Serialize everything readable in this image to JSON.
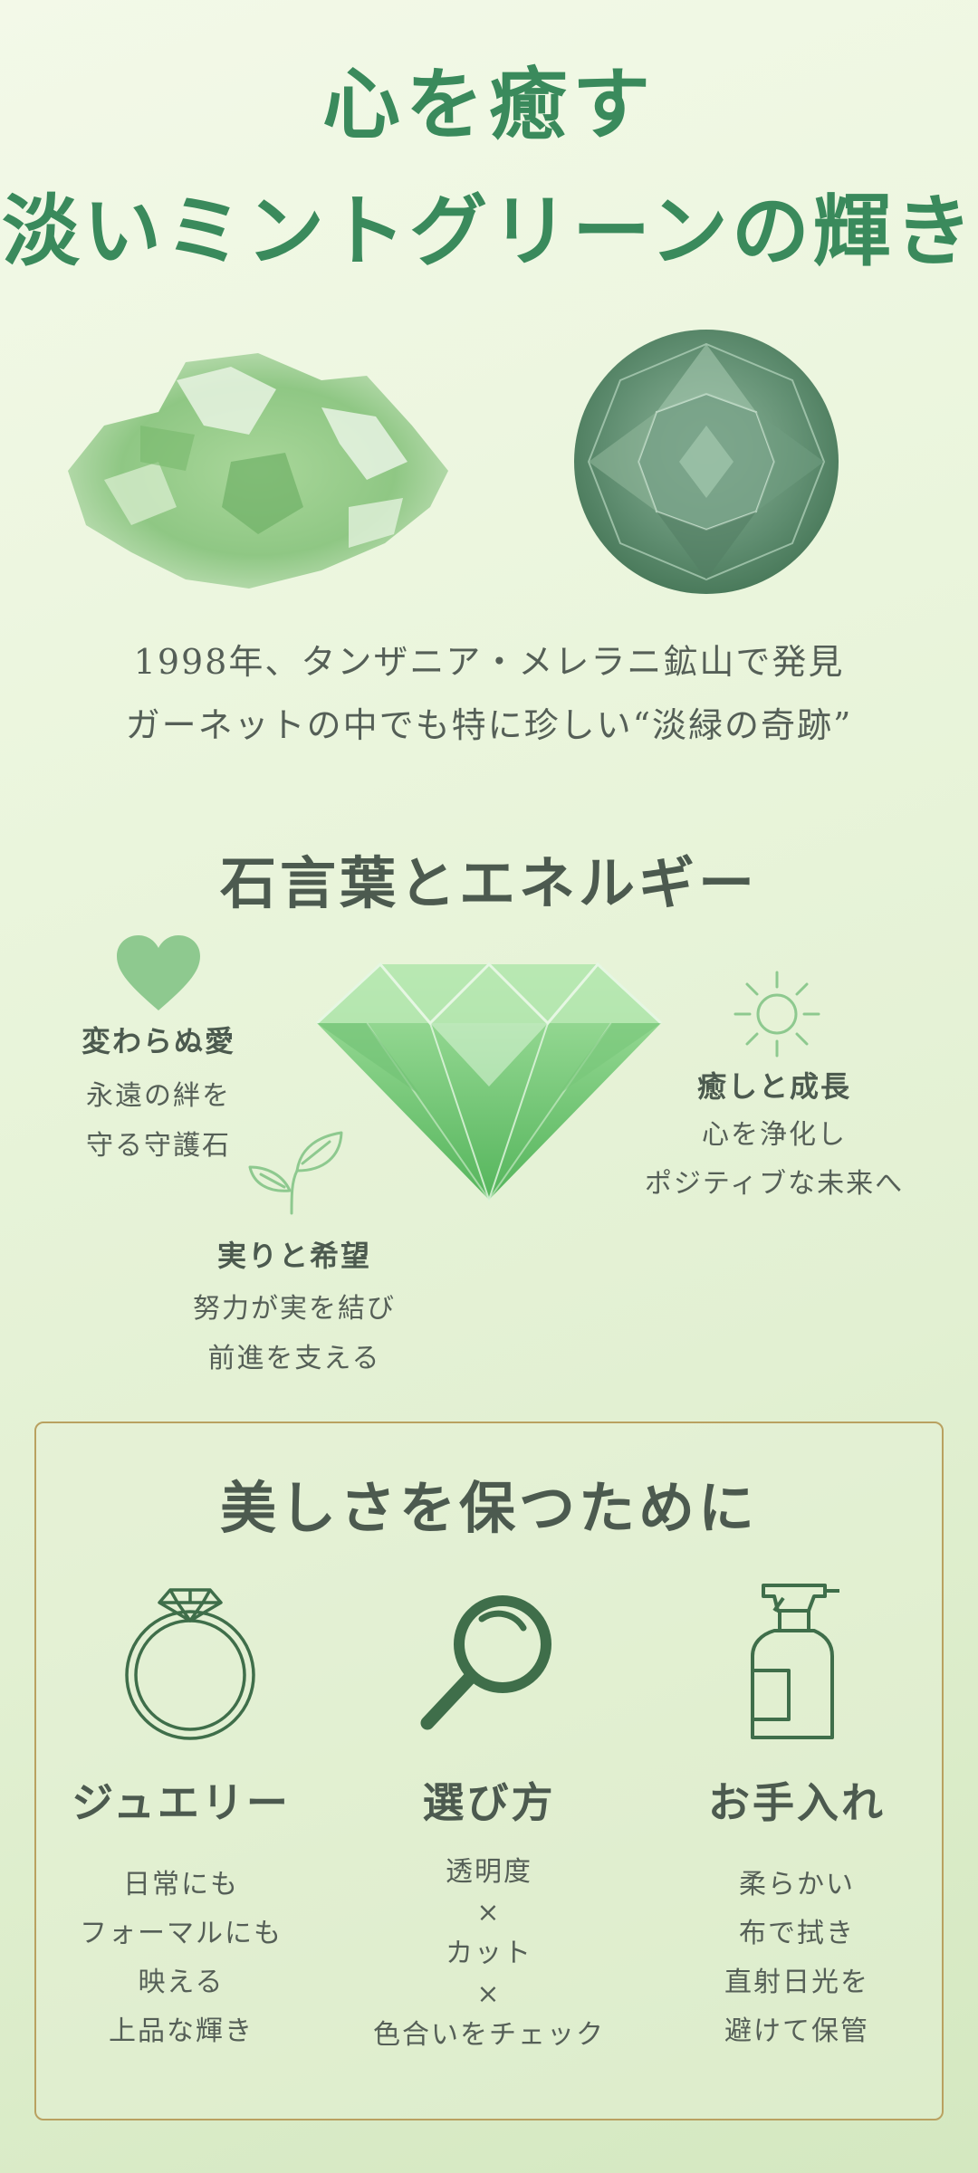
{
  "hero": {
    "title_line1": "心を癒す",
    "title_line2": "淡いミントグリーンの輝き"
  },
  "intro": {
    "line1": "1998年、タンザニア・メレラニ鉱山で発見",
    "line2": "ガーネットの中でも特に珍しい“淡緑の奇跡”"
  },
  "meaning": {
    "title": "石言葉とエネルギー",
    "features": [
      {
        "icon": "heart-icon",
        "title": "変わらぬ愛",
        "lines": [
          "永遠の絆を",
          "守る守護石"
        ]
      },
      {
        "icon": "sun-icon",
        "title": "癒しと成長",
        "lines": [
          "心を浄化し",
          "ポジティブな未来へ"
        ]
      },
      {
        "icon": "sprout-icon",
        "title": "実りと希望",
        "lines": [
          "努力が実を結び",
          "前進を支える"
        ]
      }
    ]
  },
  "care": {
    "title": "美しさを保つために",
    "columns": [
      {
        "icon": "ring-icon",
        "title": "ジュエリー",
        "lines": [
          "日常にも",
          "フォーマルにも",
          "映える",
          "上品な輝き"
        ]
      },
      {
        "icon": "magnifier-icon",
        "title": "選び方",
        "lines": [
          "透明度",
          "×",
          "カット",
          "×",
          "色合いをチェック"
        ]
      },
      {
        "icon": "spray-icon",
        "title": "お手入れ",
        "lines": [
          "柔らかい",
          "布で拭き",
          "直射日光を",
          "避けて保管"
        ]
      }
    ]
  },
  "colors": {
    "title_green": "#3a8a5c",
    "icon_green": "#3f6e4a",
    "heart_green": "#8ec98f",
    "border_gold": "#b9a160"
  }
}
